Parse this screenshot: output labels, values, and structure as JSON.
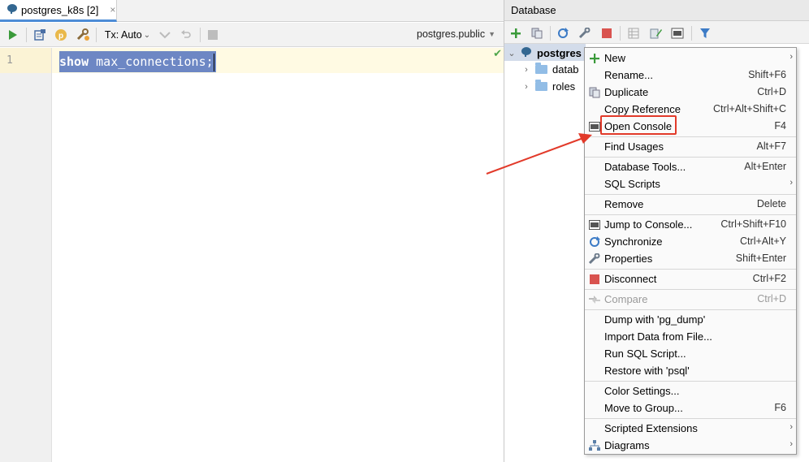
{
  "editor": {
    "tab_title": "postgres_k8s [2]",
    "tab_close": "×",
    "tx_label": "Tx: Auto",
    "schema": "postgres.public",
    "line_number": "1",
    "code_keyword": "show",
    "code_rest": " max_connections;"
  },
  "database_panel": {
    "title": "Database",
    "tree": {
      "root": "postgres",
      "children": [
        "datab",
        "roles"
      ]
    }
  },
  "context_menu": {
    "items": [
      {
        "label": "New",
        "shortcut": "",
        "submenu": true,
        "icon": "plus-icon"
      },
      {
        "label": "Rename...",
        "shortcut": "Shift+F6"
      },
      {
        "label": "Duplicate",
        "shortcut": "Ctrl+D",
        "icon": "duplicate-icon"
      },
      {
        "label": "Copy Reference",
        "shortcut": "Ctrl+Alt+Shift+C"
      },
      {
        "label": "Open Console",
        "shortcut": "F4",
        "icon": "console-icon"
      },
      {
        "label": "Find Usages",
        "shortcut": "Alt+F7"
      },
      {
        "label": "Database Tools...",
        "shortcut": "Alt+Enter"
      },
      {
        "label": "SQL Scripts",
        "shortcut": "",
        "submenu": true
      },
      {
        "label": "Remove",
        "shortcut": "Delete"
      },
      {
        "label": "Jump to Console...",
        "shortcut": "Ctrl+Shift+F10",
        "icon": "console-icon"
      },
      {
        "label": "Synchronize",
        "shortcut": "Ctrl+Alt+Y",
        "icon": "sync-icon"
      },
      {
        "label": "Properties",
        "shortcut": "Shift+Enter",
        "icon": "wrench-icon"
      },
      {
        "label": "Disconnect",
        "shortcut": "Ctrl+F2",
        "icon": "stop-icon"
      },
      {
        "label": "Compare",
        "shortcut": "Ctrl+D",
        "disabled": true,
        "icon": "compare-icon"
      },
      {
        "label": "Dump with 'pg_dump'",
        "shortcut": ""
      },
      {
        "label": "Import Data from File...",
        "shortcut": ""
      },
      {
        "label": "Run SQL Script...",
        "shortcut": ""
      },
      {
        "label": "Restore with 'psql'",
        "shortcut": ""
      },
      {
        "label": "Color Settings...",
        "shortcut": ""
      },
      {
        "label": "Move to Group...",
        "shortcut": "F6"
      },
      {
        "label": "Scripted Extensions",
        "shortcut": "",
        "submenu": true
      },
      {
        "label": "Diagrams",
        "shortcut": "",
        "submenu": true,
        "icon": "diagram-icon"
      }
    ]
  },
  "colors": {
    "selection": "#6d87c4",
    "highlight_box": "#e23a2a",
    "arrow": "#e23a2a",
    "run_green": "#3a9a3a"
  }
}
